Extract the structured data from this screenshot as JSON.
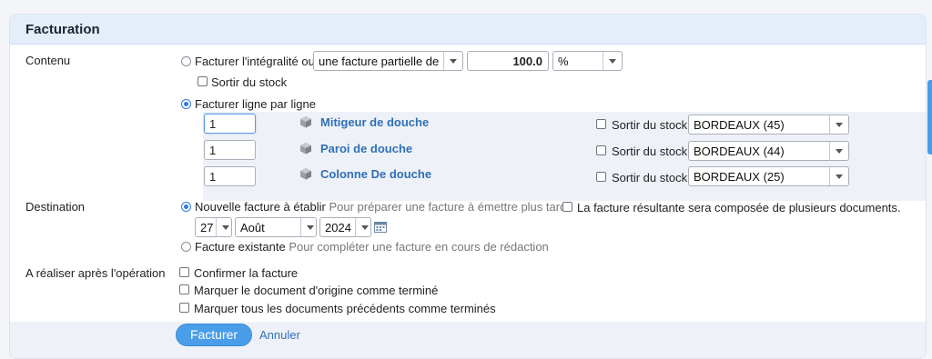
{
  "panel": {
    "title": "Facturation"
  },
  "contenu": {
    "label": "Contenu",
    "radio_full": "Facturer l'intégralité ou",
    "partial_select": "une facture partielle de",
    "partial_value": "100.0",
    "unit_select": "%",
    "full_stock_label": "Sortir du stock",
    "radio_line": "Facturer ligne par ligne",
    "stock_label": "Sortir du stock",
    "lines": [
      {
        "qty": "1",
        "product": "Mitigeur de douche",
        "warehouse": "BORDEAUX (45)"
      },
      {
        "qty": "1",
        "product": "Paroi de douche",
        "warehouse": "BORDEAUX (44)"
      },
      {
        "qty": "1",
        "product": "Colonne De douche",
        "warehouse": "BORDEAUX (25)"
      }
    ]
  },
  "destination": {
    "label": "Destination",
    "new_invoice": "Nouvelle facture à établir",
    "new_invoice_hint": "Pour préparer une facture à émettre plus tard",
    "multi_docs": "La facture résultante sera composée de plusieurs documents.",
    "day": "27",
    "month": "Août",
    "year": "2024",
    "existing_invoice": "Facture existante",
    "existing_invoice_hint": "Pour compléter une facture en cours de rédaction"
  },
  "after": {
    "label": "A réaliser après l'opération",
    "options": [
      "Confirmer la facture",
      "Marquer le document d'origine comme terminé",
      "Marquer tous les documents précédents comme terminés"
    ]
  },
  "actions": {
    "submit": "Facturer",
    "cancel": "Annuler"
  },
  "colors": {
    "accent": "#4a9de8",
    "header_bg": "#e4eefb",
    "link": "#2f6fb6"
  }
}
